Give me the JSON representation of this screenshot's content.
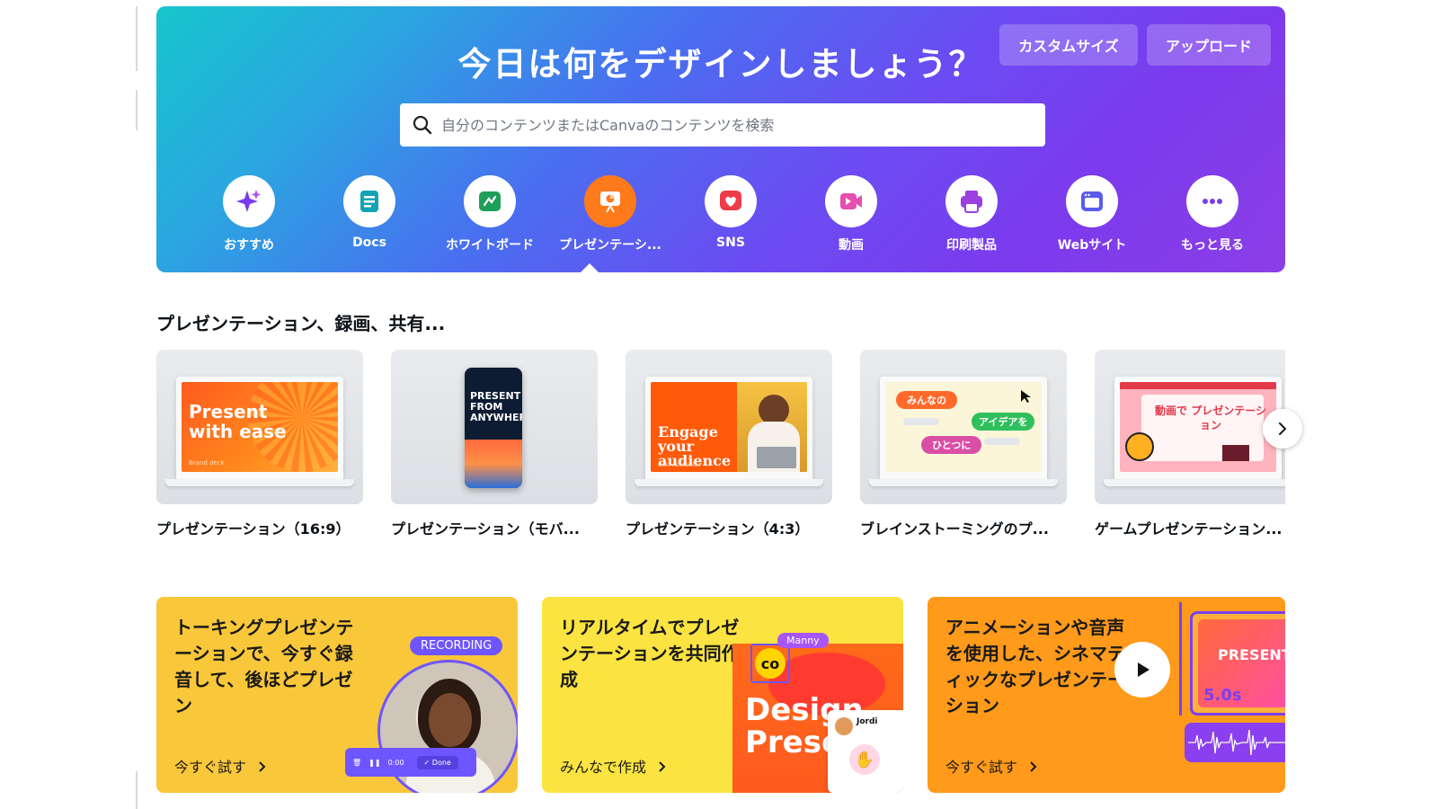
{
  "hero": {
    "title": "今日は何をデザインしましょう？",
    "custom_size": "カスタムサイズ",
    "upload": "アップロード",
    "search_placeholder": "自分のコンテンツまたはCanvaのコンテンツを検索",
    "categories": [
      {
        "label": "おすすめ",
        "icon": "sparkle-icon",
        "color": "#7c3aed"
      },
      {
        "label": "Docs",
        "icon": "docs-icon",
        "color": "#13a3b5"
      },
      {
        "label": "ホワイトボード",
        "icon": "whiteboard-icon",
        "color": "#1e9e5a"
      },
      {
        "label": "プレゼンテーシ...",
        "icon": "presentation-icon",
        "color": "#ff7a1a",
        "selected": true
      },
      {
        "label": "SNS",
        "icon": "heart-icon",
        "color": "#ef3b4a"
      },
      {
        "label": "動画",
        "icon": "video-icon",
        "color": "#e64fb0"
      },
      {
        "label": "印刷製品",
        "icon": "printer-icon",
        "color": "#9b3fe0"
      },
      {
        "label": "Webサイト",
        "icon": "website-icon",
        "color": "#5b5bf0"
      },
      {
        "label": "もっと見る",
        "icon": "more-icon",
        "color": "#7c3aed"
      }
    ]
  },
  "section": {
    "title": "プレゼンテーション、録画、共有...",
    "cards": [
      {
        "label": "プレゼンテーション（16:9）",
        "thumb_text": "Present with ease",
        "thumb_sub": "Brand deck"
      },
      {
        "label": "プレゼンテーション（モバ...",
        "thumb_text": "PRESENT FROM ANYWHERE"
      },
      {
        "label": "プレゼンテーション（4:3）",
        "thumb_text": "Engage your audience",
        "thumb_sub": "Coro Associates"
      },
      {
        "label": "ブレインストーミングのプ...",
        "thumb_words": [
          "みんなの",
          "アイデアを",
          "ひとつに"
        ]
      },
      {
        "label": "ゲームプレゼンテーション...",
        "thumb_text": "動画で プレゼンテーション"
      }
    ]
  },
  "promos": [
    {
      "title": "トーキングプレゼンテーションで、今すぐ録音して、後ほどプレゼン",
      "link": "今すぐ試す",
      "badge": "RECORDING",
      "ctrl_time": "0:00",
      "ctrl_done": "Done",
      "bg": "#f9c73a"
    },
    {
      "title": "リアルタイムでプレゼンテーションを共同作成",
      "link": "みんなで作成",
      "tag": "Manny",
      "design_text": "Design Prese",
      "user": "Jordi",
      "bg": "#fbe341"
    },
    {
      "title": "アニメーションや音声を使用した、シネマティックなプレゼンテーション",
      "link": "今すぐ試す",
      "duration": "5.0s",
      "mini_text": "PRESENT",
      "bg": "#ff9a1a"
    }
  ]
}
